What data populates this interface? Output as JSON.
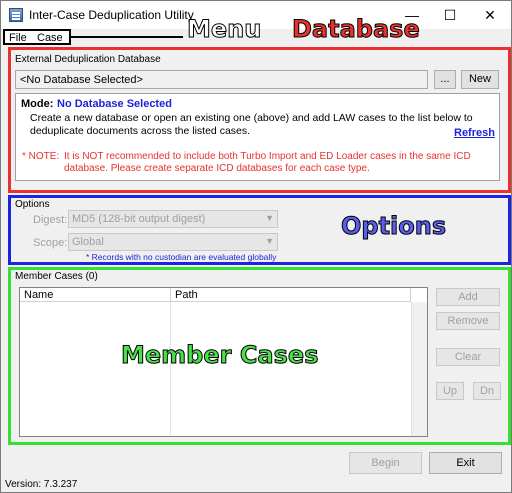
{
  "window": {
    "title": "Inter-Case Deduplication Utility",
    "controls": {
      "minimize": "—",
      "maximize": "☐",
      "close": "✕"
    }
  },
  "menu": {
    "items": [
      "File",
      "Case"
    ]
  },
  "annotations": {
    "menu": "Menu",
    "database": "Database",
    "options": "Options",
    "member_cases": "Member Cases",
    "colors": {
      "database": "#e8322c",
      "options": "#1d24e0",
      "member_cases": "#35e035"
    }
  },
  "database": {
    "group_label": "External Deduplication Database",
    "field_value": "<No Database Selected>",
    "browse_label": "...",
    "new_label": "New",
    "mode_label": "Mode:",
    "mode_value": "No Database Selected",
    "description": "Create a new database or open an existing one (above) and add LAW cases to the list below to deduplicate documents across the listed cases.",
    "refresh_label": "Refresh",
    "note_label": "* NOTE:",
    "note_text": "It is NOT recommended to include both Turbo Import and ED Loader cases in the same ICD database. Please create separate ICD databases for each case type."
  },
  "options": {
    "group_label": "Options",
    "digest_label": "Digest:",
    "digest_value": "MD5 (128-bit output digest)",
    "scope_label": "Scope:",
    "scope_value": "Global",
    "note": "* Records with no custodian are evaluated globally"
  },
  "member_cases": {
    "group_label": "Member Cases (0)",
    "columns": [
      "Name",
      "Path"
    ],
    "rows": [],
    "buttons": {
      "add": "Add",
      "remove": "Remove",
      "clear": "Clear",
      "up": "Up",
      "down": "Dn"
    }
  },
  "footer": {
    "begin_label": "Begin",
    "exit_label": "Exit",
    "version": "Version: 7.3.237"
  }
}
